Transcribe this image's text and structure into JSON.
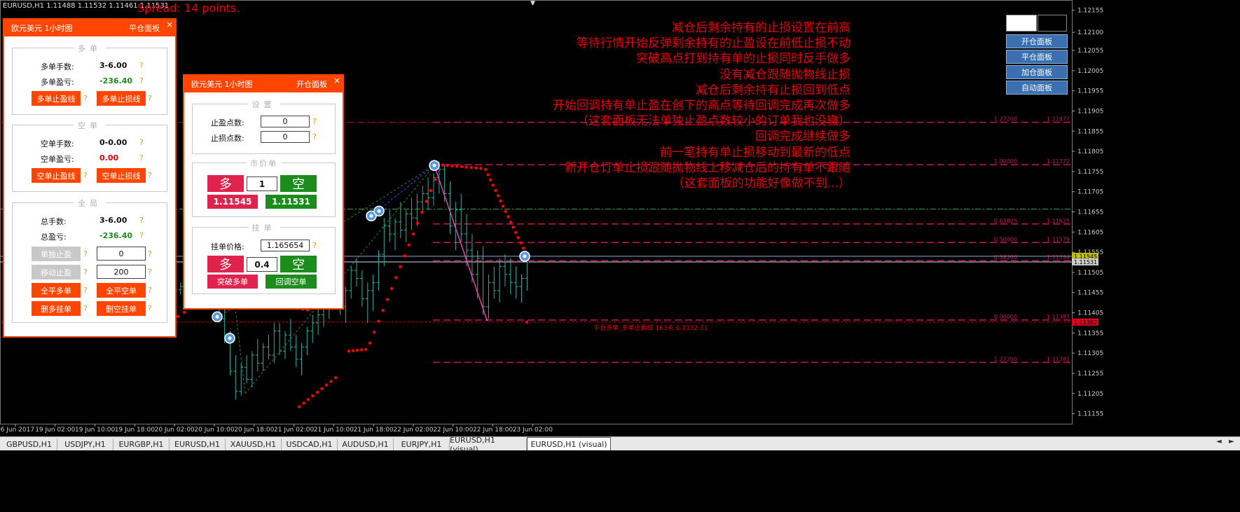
{
  "header": {
    "symbol_info": "EURUSD,H1  1.11488 1.11532 1.11461 1.11531",
    "spread": "Spread: 14 points."
  },
  "colors": {
    "accent": "#ff4500",
    "buy": "#e0234d",
    "sell": "#1c8c1c",
    "sar": "#ff0000",
    "fibo": "#c2185b"
  },
  "annotations": [
    "减仓后剩余持有的止损设置在前高",
    "等待行情开始反弹剩余持有的止盈设在前低止损不动",
    "突破高点打到持有单的止损同时反手做多",
    "没有减仓跟随抛物线止损",
    "减仓后剩余持有止损回到低点",
    "开始回调持有单止盈在创下的高点等待回调完成再次做多",
    "（这套面板无法单独止盈点数较小的订单我也没辙）",
    "回调完成继续做多",
    "前一笔持有单止损移动到最新的低点",
    "新开仓订单止损跟随抛物线上移减仓后的持有单不跟随",
    "（这套面板的功能好像做不到...）"
  ],
  "panel1": {
    "title": "欧元美元 1小时图",
    "link": "平仓面板",
    "long_group": "多单",
    "long_lots_label": "多单手数:",
    "long_lots": "3-6.00",
    "long_pl_label": "多单盈亏:",
    "long_pl": "-236.40",
    "long_tp_btn": "多单止盈线",
    "long_sl_btn": "多单止损线",
    "short_group": "空单",
    "short_lots_label": "空单手数:",
    "short_lots": "0-0.00",
    "short_pl_label": "空单盈亏:",
    "short_pl": "0.00",
    "short_tp_btn": "空单止盈线",
    "short_sl_btn": "空单止损线",
    "global_group": "全局",
    "total_lots_label": "总手数:",
    "total_lots": "3-6.00",
    "total_pl_label": "总盈亏:",
    "total_pl": "-236.40",
    "single_tp_btn": "单独止盈",
    "single_tp_val": "0",
    "move_tp_btn": "移动止盈",
    "move_tp_val": "200",
    "close_all_long": "全平多单",
    "close_all_short": "全平空单",
    "del_long_pending": "删多挂单",
    "del_short_pending": "删空挂单",
    "q": "?"
  },
  "panel2": {
    "title": "欧元美元 1小时图",
    "link": "开仓面板",
    "settings_group": "设置",
    "tp_label": "止盈点数:",
    "tp_val": "0",
    "sl_label": "止损点数:",
    "sl_val": "0",
    "market_group": "市价单",
    "buy": "多",
    "sell": "空",
    "lots": "1",
    "bid": "1.11545",
    "ask": "1.11531",
    "pending_group": "挂单",
    "pending_price_label": "挂单价格:",
    "pending_price": "1.165654",
    "pending_lots": "0.4",
    "breakout_long": "突破多单",
    "pullback_short": "回调空单",
    "q": "?"
  },
  "right_buttons": [
    "开仓面板",
    "平仓面板",
    "加仓面板",
    "自动面板"
  ],
  "price_axis": [
    "1.12155",
    "1.12100",
    "1.12055",
    "1.12005",
    "1.11955",
    "1.11905",
    "1.11855",
    "1.11805",
    "1.11755",
    "1.11705",
    "1.11655",
    "1.11605",
    "1.11555",
    "1.11505",
    "1.11455",
    "1.11405",
    "1.11355",
    "1.11305",
    "1.11255",
    "1.11205",
    "1.11155"
  ],
  "price_tags": {
    "current_buy": "1.11545",
    "current_sell": "1.11531",
    "stop": "1.11382"
  },
  "fibo": [
    {
      "level": "1.27200",
      "price": "1.11877"
    },
    {
      "level": "1.00000",
      "price": "1.11772"
    },
    {
      "level": "0.61805",
      "price": "1.11625"
    },
    {
      "level": "0.50000",
      "price": "1.11579"
    },
    {
      "level": "0.38200",
      "price": "1.11534"
    },
    {
      "level": "0.00000",
      "price": "1.11387"
    },
    {
      "level": "1.27200",
      "price": "1.11282"
    }
  ],
  "close_note": "平仓多单_多单止损线 163点 $-1132.31",
  "time_axis": [
    "16 Jun 2017",
    "19 Jun 02:00",
    "19 Jun 10:00",
    "19 Jun 18:00",
    "20 Jun 02:00",
    "20 Jun 10:00",
    "20 Jun 18:00",
    "21 Jun 02:00",
    "21 Jun 10:00",
    "21 Jun 18:00",
    "22 Jun 02:00",
    "22 Jun 10:00",
    "22 Jun 18:00",
    "23 Jun 02:00"
  ],
  "tabs": [
    "GBPUSD,H1",
    "USDJPY,H1",
    "EURGBP,H1",
    "EURUSD,H1",
    "XAUUSD,H1",
    "USDCAD,H1",
    "AUDUSD,H1",
    "EURJPY,H1",
    "EURUSD,H1 (visual)",
    "EURUSD,H1 (visual)"
  ],
  "active_tab": 9,
  "candles": [
    [
      1.11455,
      1.1147,
      1.1144,
      1.11462
    ],
    [
      1.11462,
      1.1148,
      1.1145,
      1.1147
    ],
    [
      1.1147,
      1.11475,
      1.1143,
      1.1144
    ],
    [
      1.1144,
      1.1146,
      1.1142,
      1.1145
    ],
    [
      1.1145,
      1.115,
      1.1144,
      1.1149
    ],
    [
      1.1149,
      1.1153,
      1.1147,
      1.1151
    ],
    [
      1.1151,
      1.1152,
      1.1146,
      1.1147
    ],
    [
      1.1147,
      1.1149,
      1.1144,
      1.11455
    ],
    [
      1.11455,
      1.1147,
      1.1138,
      1.1139
    ],
    [
      1.1139,
      1.1142,
      1.1133,
      1.1134
    ],
    [
      1.1134,
      1.1136,
      1.1125,
      1.1126
    ],
    [
      1.1126,
      1.113,
      1.1119,
      1.1121
    ],
    [
      1.1121,
      1.1128,
      1.112,
      1.1127
    ],
    [
      1.1127,
      1.113,
      1.1123,
      1.1124
    ],
    [
      1.1124,
      1.1131,
      1.1122,
      1.113
    ],
    [
      1.113,
      1.1134,
      1.1126,
      1.1128
    ],
    [
      1.1128,
      1.1133,
      1.1126,
      1.1132
    ],
    [
      1.1132,
      1.1135,
      1.1129,
      1.113
    ],
    [
      1.113,
      1.1138,
      1.1128,
      1.1136
    ],
    [
      1.1136,
      1.1138,
      1.113,
      1.1131
    ],
    [
      1.1131,
      1.1136,
      1.1129,
      1.1135
    ],
    [
      1.1135,
      1.1139,
      1.1131,
      1.1132
    ],
    [
      1.1132,
      1.1135,
      1.1127,
      1.1129
    ],
    [
      1.1129,
      1.1133,
      1.1125,
      1.1132
    ],
    [
      1.1132,
      1.1137,
      1.113,
      1.1136
    ],
    [
      1.1136,
      1.114,
      1.1133,
      1.1138
    ],
    [
      1.1138,
      1.1142,
      1.1135,
      1.114
    ],
    [
      1.114,
      1.1144,
      1.1137,
      1.1143
    ],
    [
      1.1143,
      1.1147,
      1.1139,
      1.1145
    ],
    [
      1.1145,
      1.115,
      1.1142,
      1.1148
    ],
    [
      1.1148,
      1.1149,
      1.114,
      1.1142
    ],
    [
      1.1142,
      1.1147,
      1.1138,
      1.1146
    ],
    [
      1.1146,
      1.1152,
      1.1144,
      1.1151
    ],
    [
      1.1151,
      1.1154,
      1.1147,
      1.1149
    ],
    [
      1.1149,
      1.1151,
      1.1142,
      1.1144
    ],
    [
      1.1144,
      1.1148,
      1.1138,
      1.1146
    ],
    [
      1.1146,
      1.115,
      1.1141,
      1.1148
    ],
    [
      1.1148,
      1.1156,
      1.1146,
      1.1155
    ],
    [
      1.1155,
      1.1164,
      1.1152,
      1.1162
    ],
    [
      1.1162,
      1.1166,
      1.1158,
      1.116
    ],
    [
      1.116,
      1.1164,
      1.1156,
      1.1163
    ],
    [
      1.1163,
      1.1168,
      1.1159,
      1.1161
    ],
    [
      1.1161,
      1.1166,
      1.1158,
      1.1165
    ],
    [
      1.1165,
      1.1169,
      1.1161,
      1.1164
    ],
    [
      1.1164,
      1.117,
      1.1162,
      1.1168
    ],
    [
      1.1168,
      1.1172,
      1.1165,
      1.117
    ],
    [
      1.117,
      1.1174,
      1.1166,
      1.1169
    ],
    [
      1.1169,
      1.1175,
      1.1167,
      1.1174
    ],
    [
      1.1174,
      1.1178,
      1.117,
      1.1176
    ],
    [
      1.1176,
      1.1177,
      1.1168,
      1.117
    ],
    [
      1.117,
      1.1173,
      1.116,
      1.1162
    ],
    [
      1.1162,
      1.1168,
      1.1156,
      1.1166
    ],
    [
      1.1166,
      1.117,
      1.1158,
      1.116
    ],
    [
      1.116,
      1.1165,
      1.1152,
      1.1156
    ],
    [
      1.1156,
      1.116,
      1.1148,
      1.115
    ],
    [
      1.115,
      1.1156,
      1.1144,
      1.1154
    ],
    [
      1.1154,
      1.1157,
      1.114,
      1.1142
    ],
    [
      1.1142,
      1.115,
      1.1139,
      1.1148
    ],
    [
      1.1148,
      1.1152,
      1.1144,
      1.1146
    ],
    [
      1.1146,
      1.1154,
      1.1143,
      1.1152
    ],
    [
      1.1152,
      1.1155,
      1.1147,
      1.115
    ],
    [
      1.115,
      1.1154,
      1.1145,
      1.1148
    ],
    [
      1.1148,
      1.1152,
      1.1144,
      1.1147
    ],
    [
      1.1147,
      1.115,
      1.1143,
      1.1149
    ],
    [
      1.1149,
      1.1153,
      1.1146,
      1.11531
    ]
  ]
}
